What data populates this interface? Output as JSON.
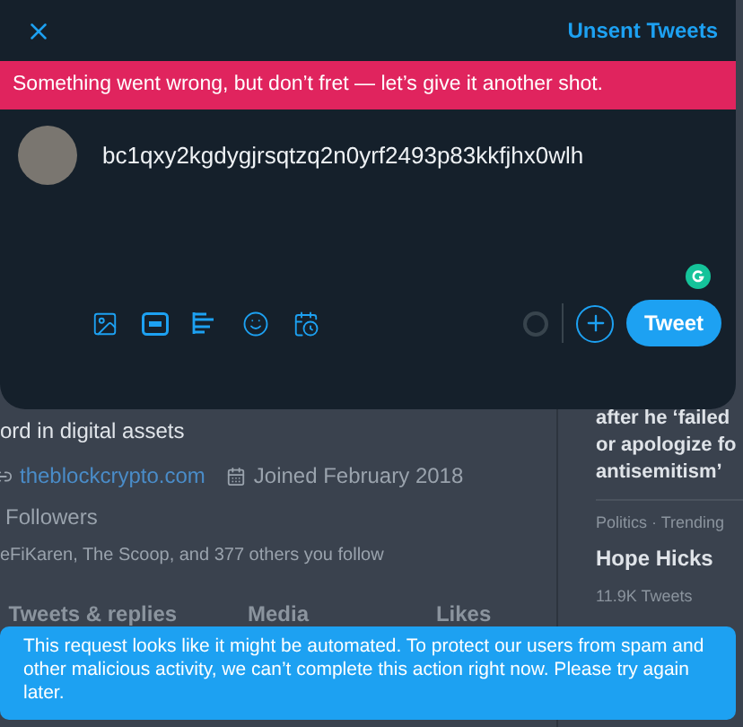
{
  "compose": {
    "header_link": "Unsent Tweets",
    "error_banner": "Something went wrong, but don’t fret — let’s give it another shot.",
    "tweet_text": "bc1qxy2kgdygjrsqtzq2n0yrf2493p83kkfjhx0wlh",
    "tweet_button": "Tweet"
  },
  "profile": {
    "bio": "ord in digital assets",
    "website": "theblockcrypto.com",
    "joined": "Joined February 2018",
    "followers": "Followers",
    "followed_by": "eFiKaren, The Scoop, and 377 others you follow",
    "tabs": [
      {
        "label": "Tweets & replies",
        "selected": false
      },
      {
        "label": "Media",
        "selected": false
      },
      {
        "label": "Likes",
        "selected": false
      }
    ]
  },
  "trends": {
    "headline": "after he ‘failed or apologize fo antisemitism’",
    "category": "Politics · Trending",
    "topic": "Hope Hicks",
    "count": "11.9K Tweets"
  },
  "toast": "This request looks like it might be automated. To protect our users from spam and other malicious activity, we can’t complete this action right now. Please try again later."
}
